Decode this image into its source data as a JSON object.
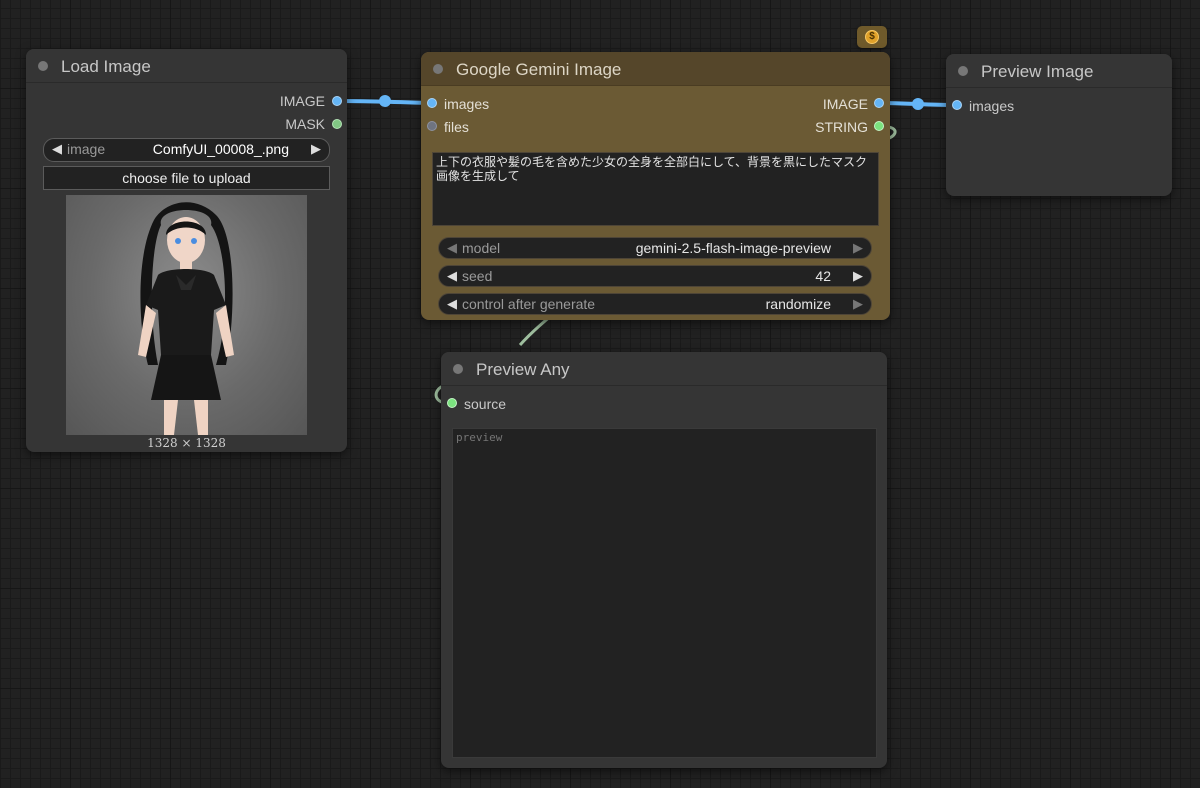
{
  "nodes": {
    "load_image": {
      "title": "Load Image",
      "outputs": {
        "image": "IMAGE",
        "mask": "MASK"
      },
      "widget_image": {
        "name": "image",
        "value": "ComfyUI_00008_.png"
      },
      "upload_label": "choose file to upload",
      "image_size": "1328 × 1328"
    },
    "gemini": {
      "title": "Google Gemini Image",
      "inputs": {
        "images": "images",
        "files": "files"
      },
      "outputs": {
        "image": "IMAGE",
        "string": "STRING"
      },
      "prompt": "上下の衣服や髪の毛を含めた少女の全身を全部白にして、背景を黒にしたマスク画像を生成して",
      "widgets": {
        "model": {
          "name": "model",
          "value": "gemini-2.5-flash-image-preview"
        },
        "seed": {
          "name": "seed",
          "value": "42"
        },
        "control": {
          "name": "control after generate",
          "value": "randomize"
        }
      },
      "badge_icon": "dollar-coin-icon",
      "badge_symbol": "$"
    },
    "preview_image": {
      "title": "Preview Image",
      "inputs": {
        "images": "images"
      }
    },
    "preview_any": {
      "title": "Preview Any",
      "inputs": {
        "source": "source"
      },
      "preview_placeholder": "preview"
    }
  },
  "colors": {
    "canvas": "#212121",
    "node": "#353535",
    "gemini_body": "#6b5a34",
    "gemini_title": "#55462a",
    "image_link": "#64b5f6",
    "string_link": "#9fbf9f"
  }
}
